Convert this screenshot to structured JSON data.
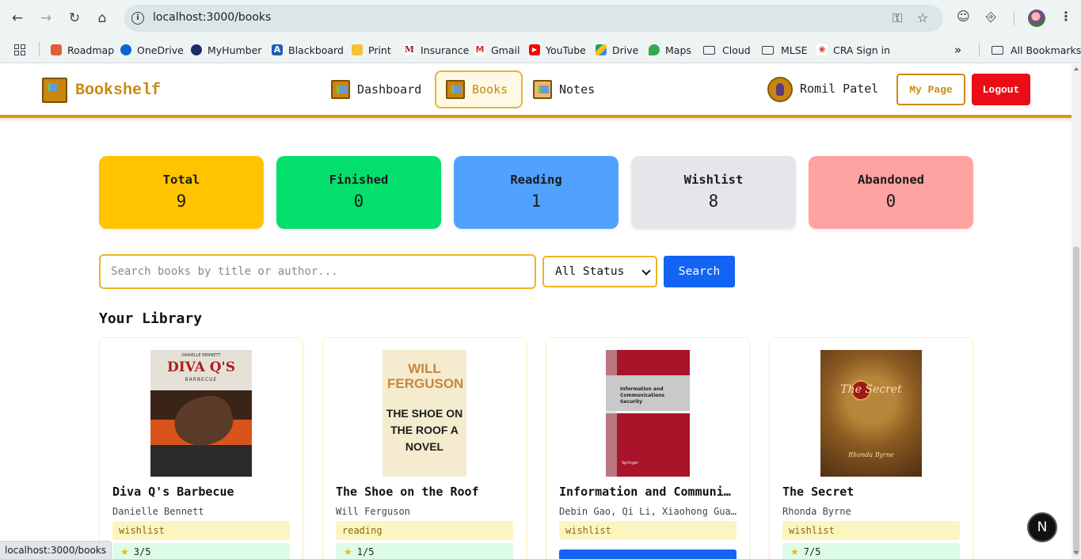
{
  "browser": {
    "url": "localhost:3000/books",
    "status_url": "localhost:3000/books",
    "bookmarks": [
      {
        "label": "Roadmap",
        "color": "#e25c3a"
      },
      {
        "label": "OneDrive",
        "color": "#0a64d4"
      },
      {
        "label": "MyHumber",
        "color": "#1b2b6b"
      },
      {
        "label": "Blackboard",
        "color": "#1f5fb0"
      },
      {
        "label": "Print",
        "color": "#f3c230"
      },
      {
        "label": "Insurance",
        "color": "#a0182a"
      },
      {
        "label": "Gmail",
        "color": "#d93025"
      },
      {
        "label": "YouTube",
        "color": "#ff0000"
      },
      {
        "label": "Drive",
        "color": "#1aa260"
      },
      {
        "label": "Maps",
        "color": "#34a853"
      },
      {
        "label": "Cloud",
        "color": "#3c4043"
      },
      {
        "label": "MLSE",
        "color": "#3c4043"
      },
      {
        "label": "CRA Sign in",
        "color": "#d52b1e"
      }
    ],
    "all_bookmarks": "All Bookmarks"
  },
  "header": {
    "brand": "Bookshelf",
    "nav": [
      "Dashboard",
      "Books",
      "Notes"
    ],
    "active_nav": "Books",
    "user_name": "Romil Patel",
    "my_page": "My Page",
    "logout": "Logout"
  },
  "stats": [
    {
      "label": "Total",
      "value": "9",
      "color": "#ffc300"
    },
    {
      "label": "Finished",
      "value": "0",
      "color": "#05df6d"
    },
    {
      "label": "Reading",
      "value": "1",
      "color": "#52a1ff"
    },
    {
      "label": "Wishlist",
      "value": "8",
      "color": "#e4e6e9"
    },
    {
      "label": "Abandoned",
      "value": "0",
      "color": "#ffa2a2"
    }
  ],
  "search": {
    "placeholder": "Search books by title or author...",
    "status_filter": "All Status",
    "button": "Search"
  },
  "library": {
    "title": "Your Library",
    "books": [
      {
        "title": "Diva Q's Barbecue",
        "author": "Danielle Bennett",
        "status": "wishlist",
        "rating": "3/5",
        "cover_title": "DIVA Q'S",
        "cover_author": "DANIELLE BENNETT",
        "cover_sub": "BARBECUE"
      },
      {
        "title": "The Shoe on the Roof",
        "author": "Will Ferguson",
        "status": "reading",
        "rating": "1/5",
        "cover_title": "WILL FERGUSON",
        "cover_sub": "THE SHOE ON THE ROOF A NOVEL"
      },
      {
        "title": "Information and Communications Security",
        "author": "Debin Gao, Qi Li, Xiaohong Guan, Xiaofeng Liao",
        "status": "wishlist",
        "rating": "",
        "cover_title": "Information and Communications Security",
        "cover_author": "Springer"
      },
      {
        "title": "The Secret",
        "author": "Rhonda Byrne",
        "status": "wishlist",
        "rating": "7/5",
        "cover_title": "The Secret",
        "cover_author": "Rhonda Byrne"
      }
    ]
  },
  "devtools_badge": "N"
}
